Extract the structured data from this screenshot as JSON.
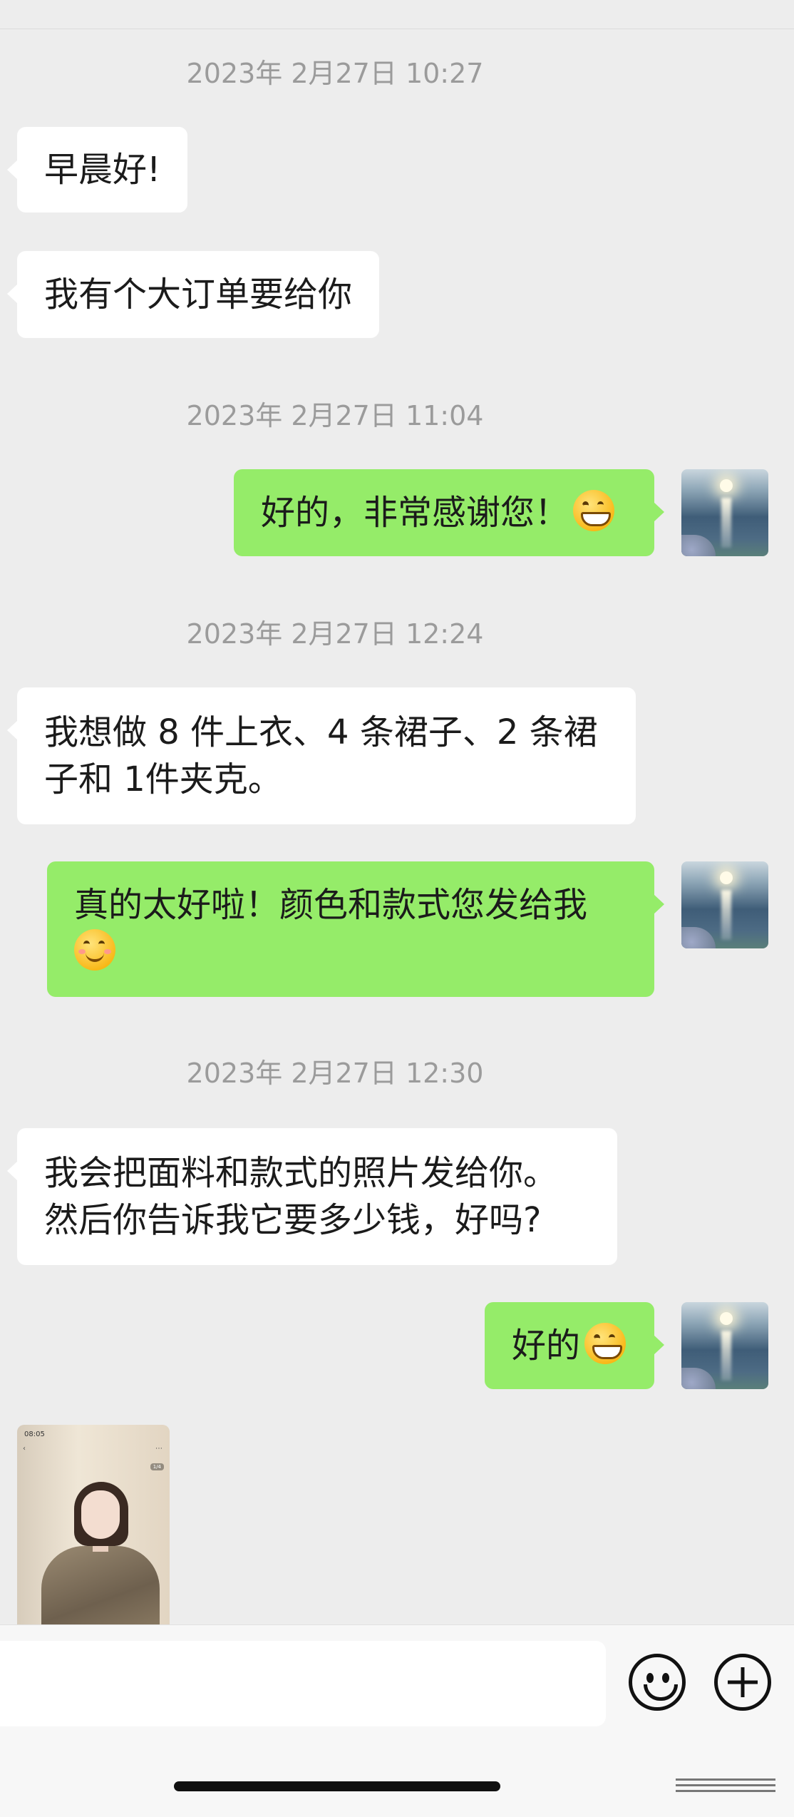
{
  "header": {
    "title_fragment": "· · ·"
  },
  "messages": [
    {
      "type": "time",
      "text": "2023年 2月27日 10:27"
    },
    {
      "type": "in",
      "text": "早晨好!"
    },
    {
      "type": "in",
      "text": "我有个大订单要给你"
    },
    {
      "type": "time",
      "text": "2023年 2月27日 11:04"
    },
    {
      "type": "out",
      "text": "好的，非常感谢您！",
      "emoji": "grin-face"
    },
    {
      "type": "time",
      "text": "2023年 2月27日 12:24"
    },
    {
      "type": "in",
      "text": "我想做 8 件上衣、4 条裙子、2 条裙\n子和 1件夹克。"
    },
    {
      "type": "out",
      "text": "真的太好啦！颜色和款式您发给我\n",
      "emoji": "smiling-face"
    },
    {
      "type": "time",
      "text": "2023年 2月27日 12:30"
    },
    {
      "type": "in",
      "text": "我会把面料和款式的照片发给你。\n然后你告诉我它要多少钱，好吗?"
    },
    {
      "type": "out",
      "text": "好的",
      "emoji": "grin-face"
    },
    {
      "type": "in-image",
      "description_icon": "product-photo"
    }
  ],
  "photo": {
    "statusbar": "08:05",
    "badge": "1/4"
  },
  "input": {
    "placeholder": ""
  },
  "icons": {
    "emoji": "emoji-icon",
    "plus": "plus-icon",
    "avatar": "avatar-image"
  }
}
